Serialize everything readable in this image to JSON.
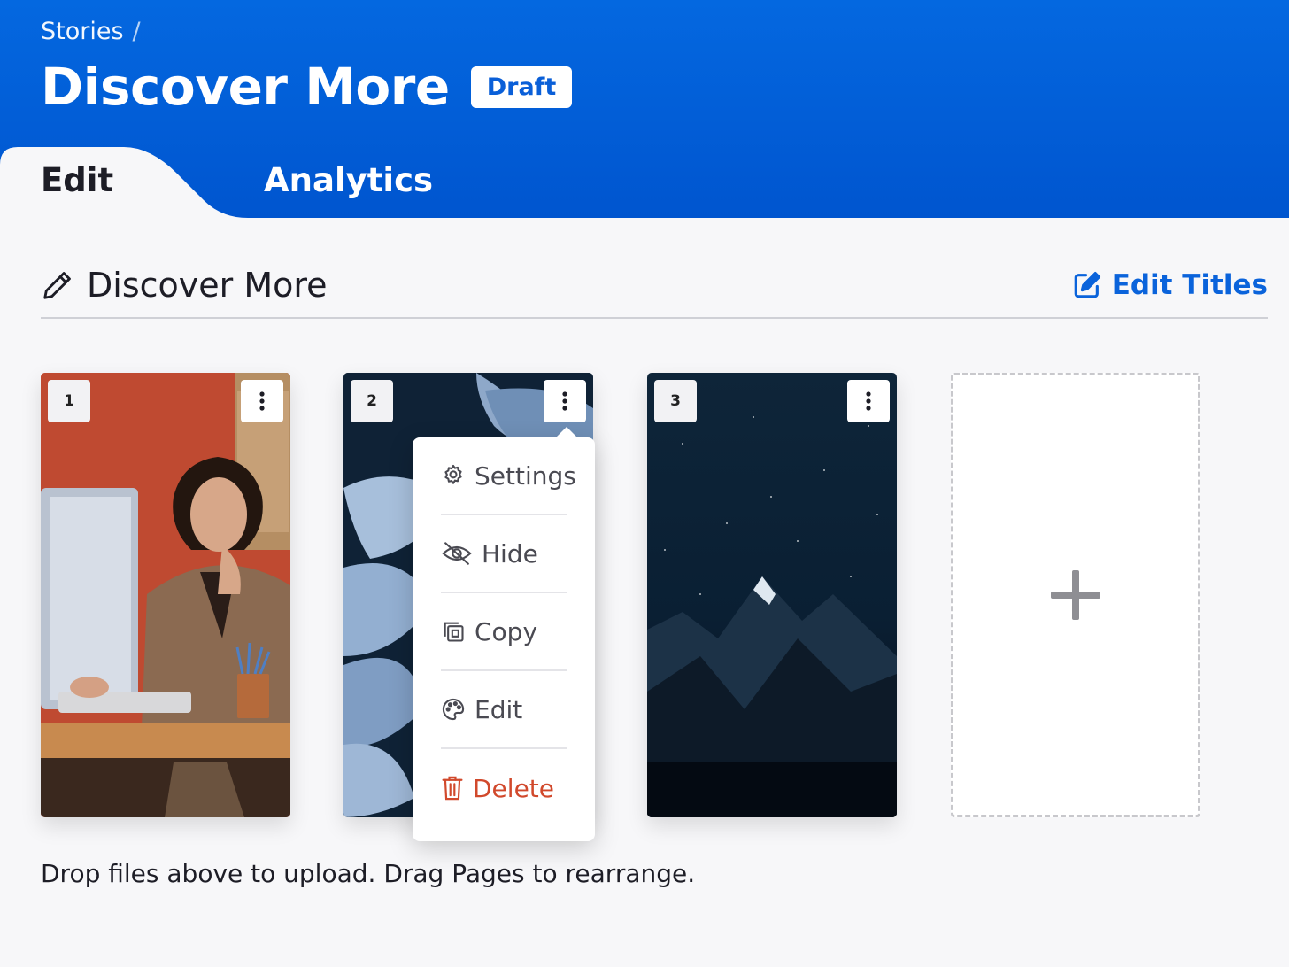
{
  "breadcrumb": {
    "parent": "Stories",
    "separator": "/"
  },
  "story": {
    "title": "Discover More",
    "status": "Draft"
  },
  "tabs": [
    {
      "label": "Edit",
      "active": true
    },
    {
      "label": "Analytics",
      "active": false
    }
  ],
  "section": {
    "title": "Discover More",
    "edit_titles_label": "Edit Titles"
  },
  "pages": [
    {
      "number": "1",
      "image": "man-at-desk-photo"
    },
    {
      "number": "2",
      "image": "blue-leaves-photo"
    },
    {
      "number": "3",
      "image": "night-mountain-photo"
    }
  ],
  "page_menu": {
    "items": [
      {
        "label": "Settings",
        "icon": "gear-icon"
      },
      {
        "label": "Hide",
        "icon": "eye-slash-icon"
      },
      {
        "label": "Copy",
        "icon": "copy-icon"
      },
      {
        "label": "Edit",
        "icon": "palette-icon"
      },
      {
        "label": "Delete",
        "icon": "trash-icon"
      }
    ]
  },
  "hint": "Drop files above to upload. Drag Pages to rearrange.",
  "colors": {
    "brand": "#0a63db",
    "danger": "#d1492c",
    "header_start": "#0468e0",
    "header_end": "#0055cf"
  }
}
